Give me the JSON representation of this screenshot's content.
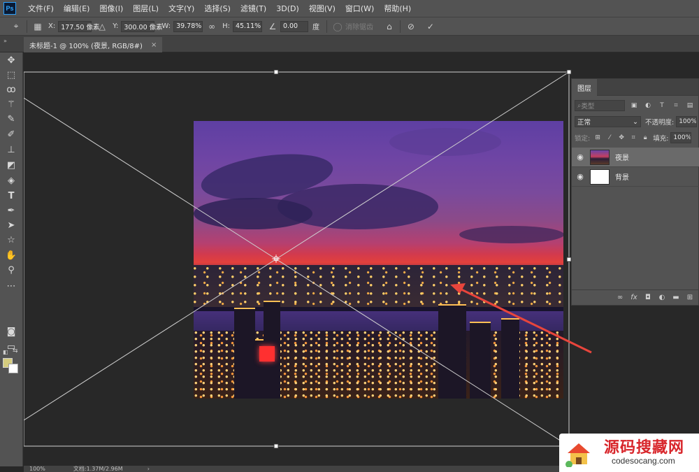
{
  "app": {
    "logo_text": "Ps"
  },
  "menu": [
    "文件(F)",
    "编辑(E)",
    "图像(I)",
    "图层(L)",
    "文字(Y)",
    "选择(S)",
    "滤镜(T)",
    "3D(D)",
    "视图(V)",
    "窗口(W)",
    "帮助(H)"
  ],
  "options": {
    "x_label": "X:",
    "x_value": "177.50 像素",
    "y_label": "Y:",
    "y_value": "300.00 像素",
    "w_label": "W:",
    "w_value": "39.78%",
    "h_label": "H:",
    "h_value": "45.11%",
    "angle_value": "0.00",
    "angle_unit": "度",
    "antialias_label": "消除锯齿"
  },
  "document": {
    "tab_title": "未标题-1 @ 100% (夜景, RGB/8#)",
    "close_glyph": "×"
  },
  "tools": [
    "move-tool",
    "marquee-tool",
    "lasso-tool",
    "magic-wand-tool",
    "eyedropper-tool",
    "brush-tool",
    "stamp-tool",
    "eraser-tool",
    "paint-bucket-tool",
    "type-tool",
    "pen-tool",
    "path-select-tool",
    "shape-tool",
    "hand-tool",
    "zoom-tool",
    "more-tools"
  ],
  "colors": {
    "foreground": "#d5cc7e",
    "background": "#ffffff",
    "accent": "#31a8ff",
    "arrow": "#e8453c"
  },
  "layers_panel": {
    "tab_label": "图层",
    "filter_placeholder": "类型",
    "blend_mode": "正常",
    "opacity_label": "不透明度:",
    "opacity_value": "100%",
    "lock_label": "锁定:",
    "fill_label": "填充:",
    "fill_value": "100%",
    "layers": [
      {
        "name": "夜景",
        "visible": true,
        "selected": true
      },
      {
        "name": "背景",
        "visible": true,
        "selected": false
      }
    ]
  },
  "status": {
    "zoom": "100%",
    "doc_info": "文档:1.37M/2.96M",
    "chevron": "›"
  },
  "watermark": {
    "title": "源码搜藏网",
    "url": "codesocang.com"
  }
}
